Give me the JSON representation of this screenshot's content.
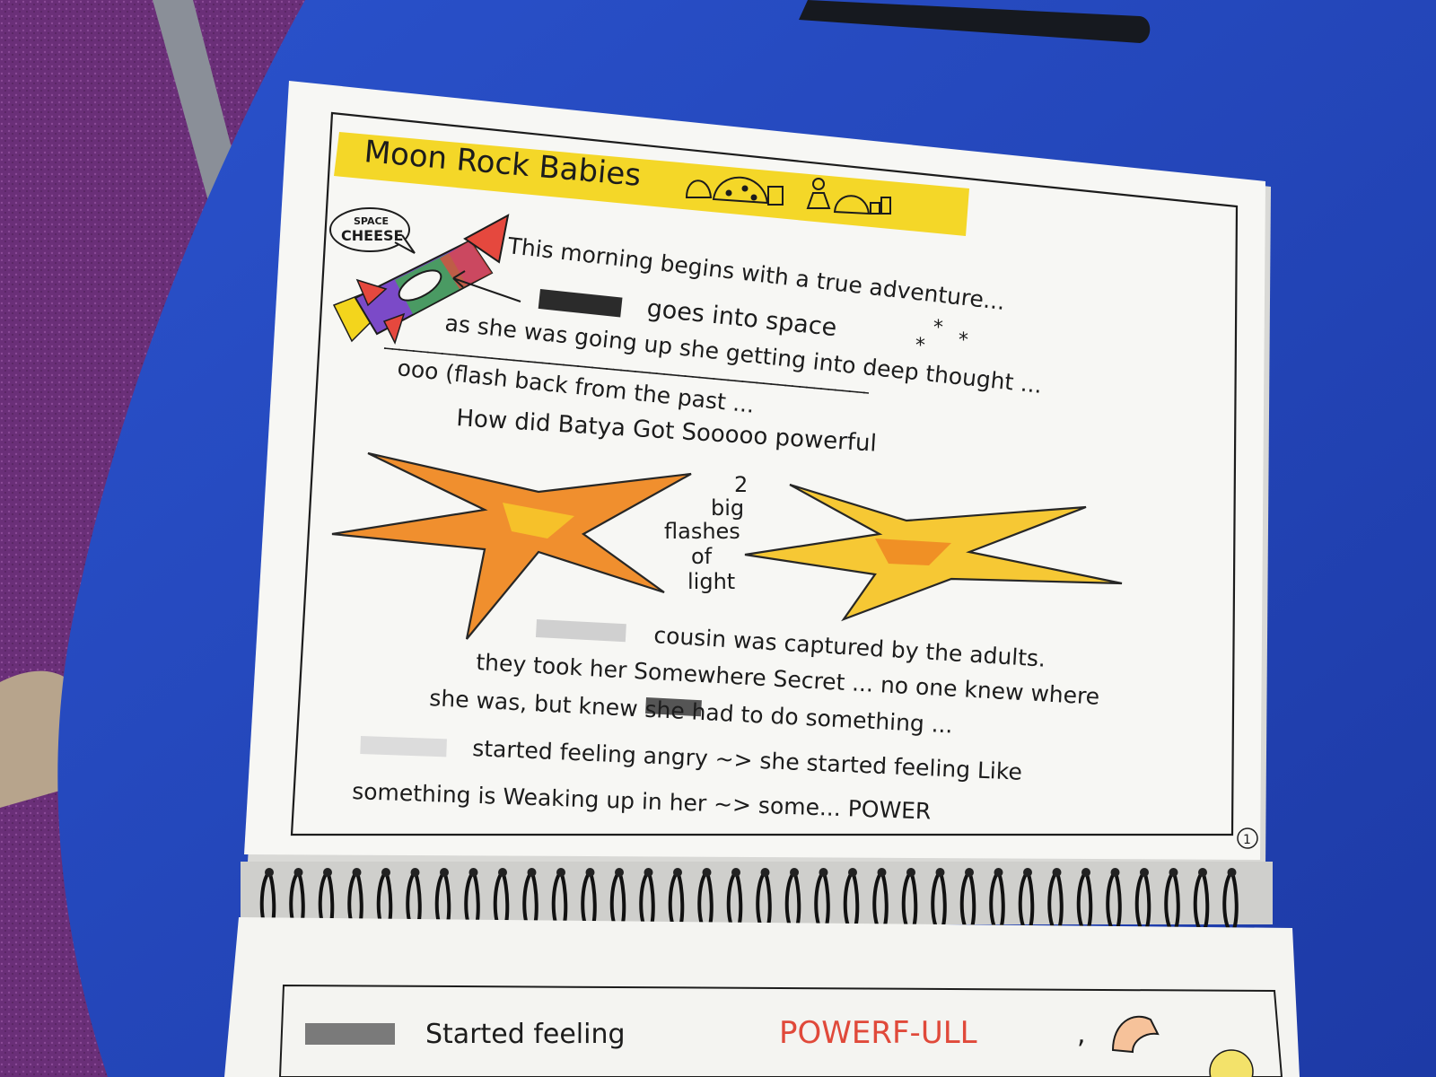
{
  "page": {
    "title": "Moon Rock Babies",
    "speech_bubble": {
      "line1": "SPACE",
      "line2": "CHEESE"
    },
    "lines": [
      "This morning begins with a true adventure...",
      "goes into space",
      "as she was going up she getting into deep thought ...",
      "ooo (flash back from the past ...",
      "How did Batya Got Sooooo powerful",
      "cousin was captured by the adults.",
      "they took her Somewhere Secret ... no one knew where",
      "she was, but knew she had to do something ...",
      "started feeling angry ~> she started feeling Like",
      "something is Weaking up in her ~> some... POWER"
    ],
    "flash_note": [
      "2",
      "big",
      "flashes",
      "of",
      "light"
    ],
    "page_number": "1"
  },
  "next_page": {
    "line_start": "Started feeling",
    "power_word": "POWERF-ULL",
    "trailing": ","
  },
  "colors": {
    "table": "#1f44b8",
    "paper": "#f7f7f4",
    "highlight": "#f3d51c",
    "flash_outer": "#f08a24",
    "flash_inner": "#f6c62a",
    "power_red": "#e0493a",
    "carpet": "#6a2f78"
  }
}
